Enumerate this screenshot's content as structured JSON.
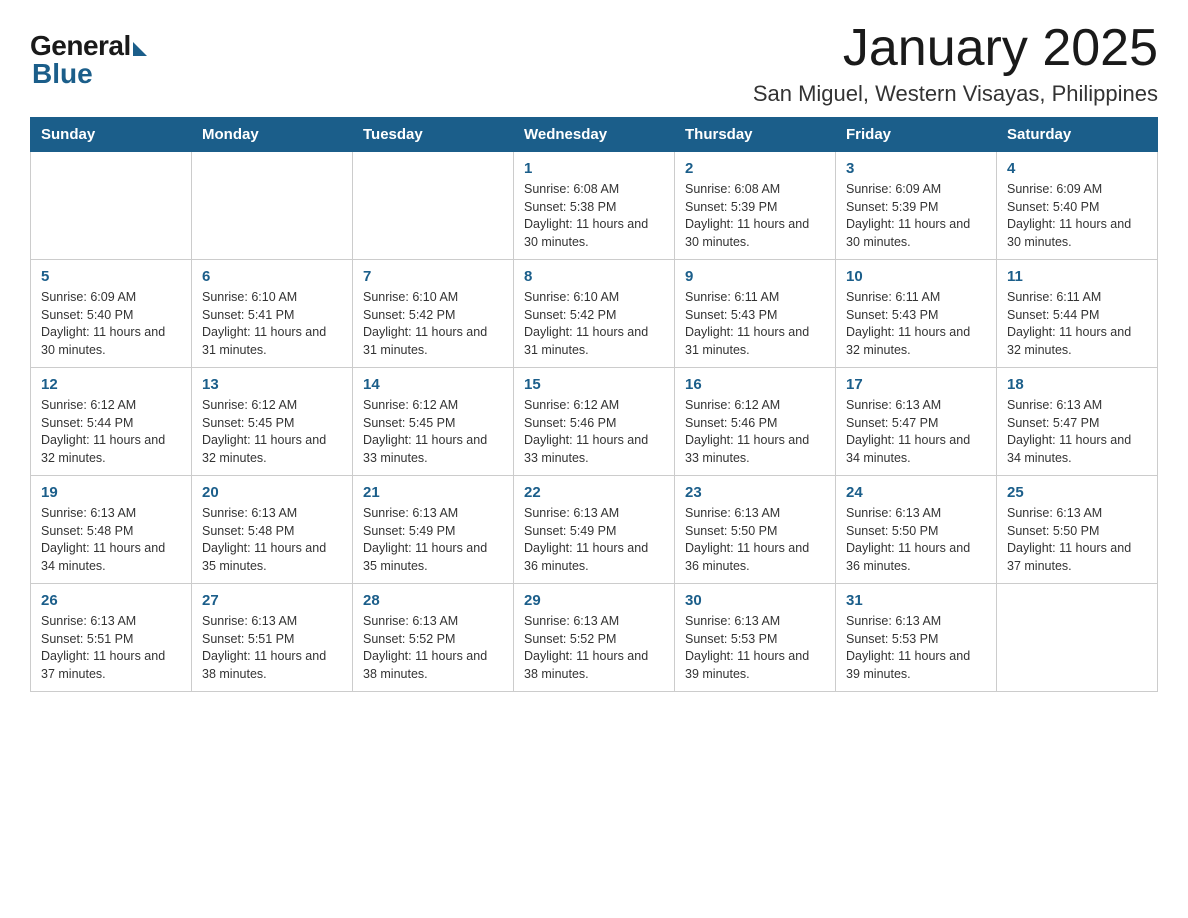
{
  "logo": {
    "general": "General",
    "blue": "Blue"
  },
  "header": {
    "month": "January 2025",
    "location": "San Miguel, Western Visayas, Philippines"
  },
  "days_of_week": [
    "Sunday",
    "Monday",
    "Tuesday",
    "Wednesday",
    "Thursday",
    "Friday",
    "Saturday"
  ],
  "weeks": [
    [
      {
        "day": "",
        "detail": ""
      },
      {
        "day": "",
        "detail": ""
      },
      {
        "day": "",
        "detail": ""
      },
      {
        "day": "1",
        "detail": "Sunrise: 6:08 AM\nSunset: 5:38 PM\nDaylight: 11 hours and 30 minutes."
      },
      {
        "day": "2",
        "detail": "Sunrise: 6:08 AM\nSunset: 5:39 PM\nDaylight: 11 hours and 30 minutes."
      },
      {
        "day": "3",
        "detail": "Sunrise: 6:09 AM\nSunset: 5:39 PM\nDaylight: 11 hours and 30 minutes."
      },
      {
        "day": "4",
        "detail": "Sunrise: 6:09 AM\nSunset: 5:40 PM\nDaylight: 11 hours and 30 minutes."
      }
    ],
    [
      {
        "day": "5",
        "detail": "Sunrise: 6:09 AM\nSunset: 5:40 PM\nDaylight: 11 hours and 30 minutes."
      },
      {
        "day": "6",
        "detail": "Sunrise: 6:10 AM\nSunset: 5:41 PM\nDaylight: 11 hours and 31 minutes."
      },
      {
        "day": "7",
        "detail": "Sunrise: 6:10 AM\nSunset: 5:42 PM\nDaylight: 11 hours and 31 minutes."
      },
      {
        "day": "8",
        "detail": "Sunrise: 6:10 AM\nSunset: 5:42 PM\nDaylight: 11 hours and 31 minutes."
      },
      {
        "day": "9",
        "detail": "Sunrise: 6:11 AM\nSunset: 5:43 PM\nDaylight: 11 hours and 31 minutes."
      },
      {
        "day": "10",
        "detail": "Sunrise: 6:11 AM\nSunset: 5:43 PM\nDaylight: 11 hours and 32 minutes."
      },
      {
        "day": "11",
        "detail": "Sunrise: 6:11 AM\nSunset: 5:44 PM\nDaylight: 11 hours and 32 minutes."
      }
    ],
    [
      {
        "day": "12",
        "detail": "Sunrise: 6:12 AM\nSunset: 5:44 PM\nDaylight: 11 hours and 32 minutes."
      },
      {
        "day": "13",
        "detail": "Sunrise: 6:12 AM\nSunset: 5:45 PM\nDaylight: 11 hours and 32 minutes."
      },
      {
        "day": "14",
        "detail": "Sunrise: 6:12 AM\nSunset: 5:45 PM\nDaylight: 11 hours and 33 minutes."
      },
      {
        "day": "15",
        "detail": "Sunrise: 6:12 AM\nSunset: 5:46 PM\nDaylight: 11 hours and 33 minutes."
      },
      {
        "day": "16",
        "detail": "Sunrise: 6:12 AM\nSunset: 5:46 PM\nDaylight: 11 hours and 33 minutes."
      },
      {
        "day": "17",
        "detail": "Sunrise: 6:13 AM\nSunset: 5:47 PM\nDaylight: 11 hours and 34 minutes."
      },
      {
        "day": "18",
        "detail": "Sunrise: 6:13 AM\nSunset: 5:47 PM\nDaylight: 11 hours and 34 minutes."
      }
    ],
    [
      {
        "day": "19",
        "detail": "Sunrise: 6:13 AM\nSunset: 5:48 PM\nDaylight: 11 hours and 34 minutes."
      },
      {
        "day": "20",
        "detail": "Sunrise: 6:13 AM\nSunset: 5:48 PM\nDaylight: 11 hours and 35 minutes."
      },
      {
        "day": "21",
        "detail": "Sunrise: 6:13 AM\nSunset: 5:49 PM\nDaylight: 11 hours and 35 minutes."
      },
      {
        "day": "22",
        "detail": "Sunrise: 6:13 AM\nSunset: 5:49 PM\nDaylight: 11 hours and 36 minutes."
      },
      {
        "day": "23",
        "detail": "Sunrise: 6:13 AM\nSunset: 5:50 PM\nDaylight: 11 hours and 36 minutes."
      },
      {
        "day": "24",
        "detail": "Sunrise: 6:13 AM\nSunset: 5:50 PM\nDaylight: 11 hours and 36 minutes."
      },
      {
        "day": "25",
        "detail": "Sunrise: 6:13 AM\nSunset: 5:50 PM\nDaylight: 11 hours and 37 minutes."
      }
    ],
    [
      {
        "day": "26",
        "detail": "Sunrise: 6:13 AM\nSunset: 5:51 PM\nDaylight: 11 hours and 37 minutes."
      },
      {
        "day": "27",
        "detail": "Sunrise: 6:13 AM\nSunset: 5:51 PM\nDaylight: 11 hours and 38 minutes."
      },
      {
        "day": "28",
        "detail": "Sunrise: 6:13 AM\nSunset: 5:52 PM\nDaylight: 11 hours and 38 minutes."
      },
      {
        "day": "29",
        "detail": "Sunrise: 6:13 AM\nSunset: 5:52 PM\nDaylight: 11 hours and 38 minutes."
      },
      {
        "day": "30",
        "detail": "Sunrise: 6:13 AM\nSunset: 5:53 PM\nDaylight: 11 hours and 39 minutes."
      },
      {
        "day": "31",
        "detail": "Sunrise: 6:13 AM\nSunset: 5:53 PM\nDaylight: 11 hours and 39 minutes."
      },
      {
        "day": "",
        "detail": ""
      }
    ]
  ]
}
